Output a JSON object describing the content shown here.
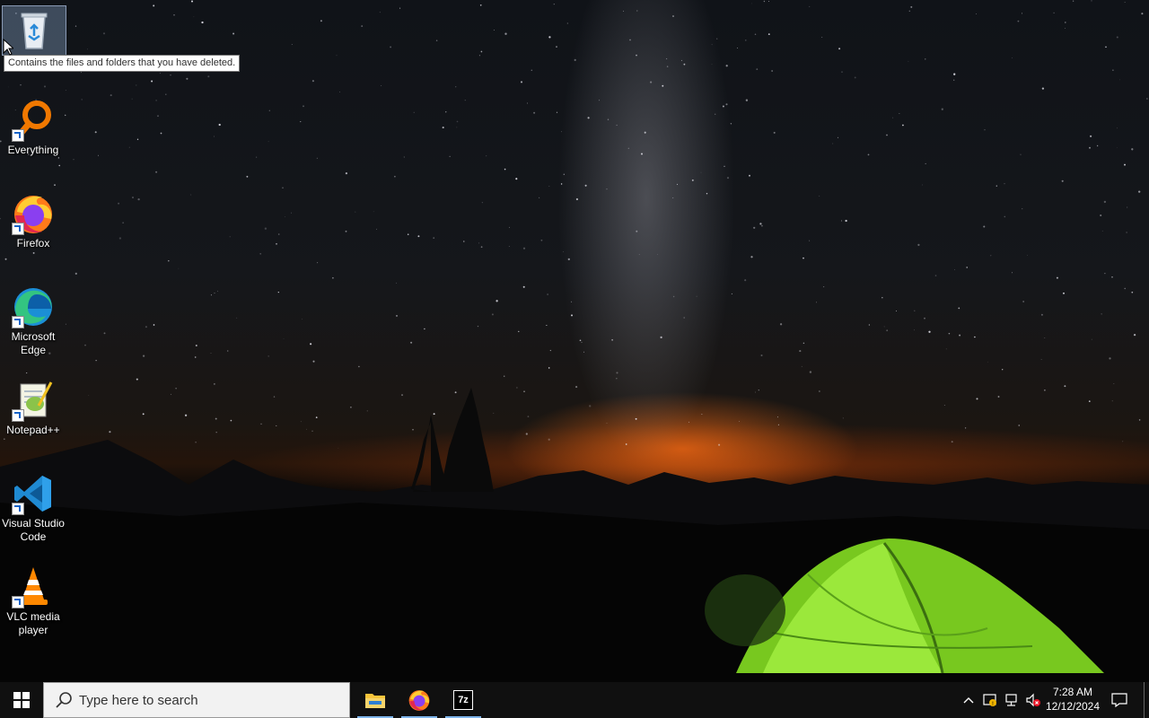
{
  "desktop": {
    "icons": [
      {
        "label": "Recycle Bin",
        "icon": "recycle-bin-icon"
      },
      {
        "label": "Everything",
        "icon": "everything-search-icon"
      },
      {
        "label": "Firefox",
        "icon": "firefox-icon"
      },
      {
        "label": "Microsoft Edge",
        "icon": "edge-icon"
      },
      {
        "label": "Notepad++",
        "icon": "notepadpp-icon"
      },
      {
        "label": "Visual Studio Code",
        "icon": "vscode-icon"
      },
      {
        "label": "VLC media player",
        "icon": "vlc-icon"
      }
    ],
    "tooltip": "Contains the files and folders that you have deleted."
  },
  "taskbar": {
    "search_placeholder": "Type here to search",
    "pinned": [
      {
        "icon": "file-explorer-icon"
      },
      {
        "icon": "firefox-icon"
      },
      {
        "icon": "7zip-icon",
        "text": "7z"
      }
    ],
    "clock": {
      "time": "7:28 AM",
      "date": "12/12/2024"
    }
  },
  "colors": {
    "taskbar_bg": "#101010",
    "running_indicator": "#7eb4ea",
    "sky_glow": "#ff6a14",
    "tent_green": "#7ed321"
  }
}
